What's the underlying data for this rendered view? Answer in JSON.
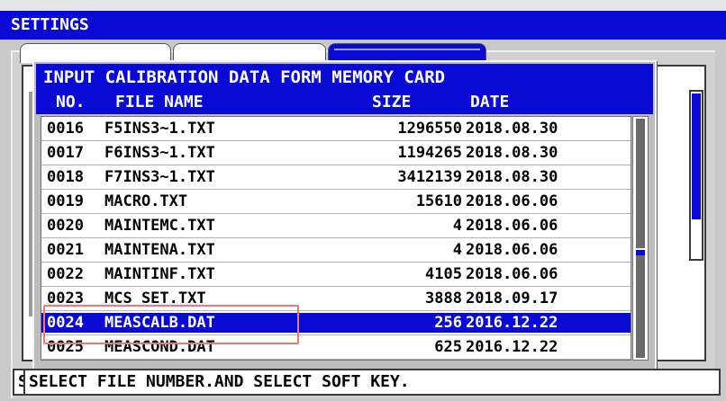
{
  "window": {
    "title": "SETTINGS"
  },
  "dialog": {
    "title": "INPUT CALIBRATION DATA FORM MEMORY CARD",
    "columns": {
      "no": "NO.",
      "file_name": "FILE NAME",
      "size": "SIZE",
      "date": "DATE"
    },
    "rows": [
      {
        "no": "0016",
        "file_name": "F5INS3~1.TXT",
        "size": "1296550",
        "date": "2018.08.30"
      },
      {
        "no": "0017",
        "file_name": "F6INS3~1.TXT",
        "size": "1194265",
        "date": "2018.08.30"
      },
      {
        "no": "0018",
        "file_name": "F7INS3~1.TXT",
        "size": "3412139",
        "date": "2018.08.30"
      },
      {
        "no": "0019",
        "file_name": "MACRO.TXT",
        "size": "15610",
        "date": "2018.06.06"
      },
      {
        "no": "0020",
        "file_name": "MAINTEMC.TXT",
        "size": "4",
        "date": "2018.06.06"
      },
      {
        "no": "0021",
        "file_name": "MAINTENA.TXT",
        "size": "4",
        "date": "2018.06.06"
      },
      {
        "no": "0022",
        "file_name": "MAINTINF.TXT",
        "size": "4105",
        "date": "2018.06.06"
      },
      {
        "no": "0023",
        "file_name": "MCS_SET.TXT",
        "size": "3888",
        "date": "2018.09.17"
      },
      {
        "no": "0024",
        "file_name": "MEASCALB.DAT",
        "size": "256",
        "date": "2016.12.22",
        "selected": true
      },
      {
        "no": "0025",
        "file_name": "MEASCOND.DAT",
        "size": "625",
        "date": "2016.12.22"
      }
    ]
  },
  "status": {
    "prefix": "S",
    "message": "SELECT FILE NUMBER.AND SELECT SOFT KEY."
  },
  "colors": {
    "accent": "#0a0ad6",
    "panel": "#bdbdbd",
    "highlight_box": "#ea7a7a"
  }
}
